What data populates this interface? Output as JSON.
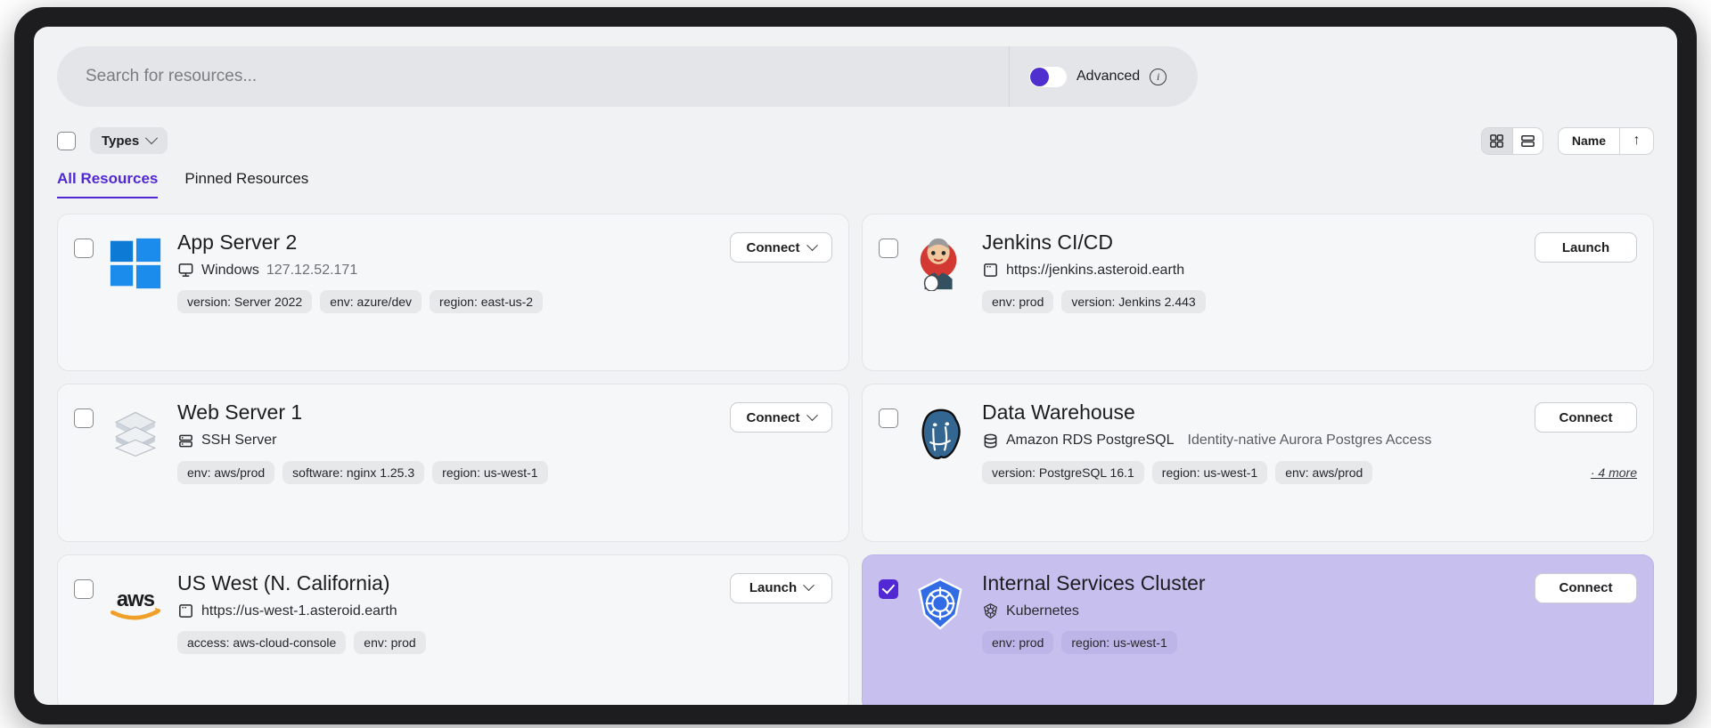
{
  "search": {
    "placeholder": "Search for resources...",
    "value": "",
    "advanced_label": "Advanced",
    "advanced_on": false,
    "info_glyph": "i"
  },
  "filters": {
    "types_label": "Types",
    "select_all_checked": false
  },
  "view": {
    "grid_active": true,
    "sort_label": "Name",
    "sort_arrow": "↑"
  },
  "tabs": [
    {
      "label": "All Resources",
      "active": true
    },
    {
      "label": "Pinned Resources",
      "active": false
    }
  ],
  "colors": {
    "accent": "#5128d4",
    "toggle_knob": "#4f30cf",
    "selected_card_bg": "#c7c0ef",
    "card_bg": "#f6f7f8",
    "page_bg": "#f1f2f4",
    "frame": "#1d1d1f"
  },
  "cards": [
    {
      "name": "App Server 2",
      "logo": "windows-logo",
      "type_icon": "monitor-icon",
      "type_label": "Windows",
      "address": "127.12.52.171",
      "description": "",
      "tags": [
        "version: Server 2022",
        "env: azure/dev",
        "region: east-us-2"
      ],
      "more_label": "",
      "action_label": "Connect",
      "action_has_chevron": true,
      "selected": false
    },
    {
      "name": "Jenkins CI/CD",
      "logo": "jenkins-logo",
      "type_icon": "app-window-icon",
      "type_label": "https://jenkins.asteroid.earth",
      "address": "",
      "description": "",
      "tags": [
        "env: prod",
        "version: Jenkins 2.443"
      ],
      "more_label": "",
      "action_label": "Launch",
      "action_has_chevron": false,
      "selected": false
    },
    {
      "name": "Web Server 1",
      "logo": "server-stack-logo",
      "type_icon": "server-rack-icon",
      "type_label": "SSH Server",
      "address": "",
      "description": "",
      "tags": [
        "env: aws/prod",
        "software: nginx 1.25.3",
        "region: us-west-1"
      ],
      "more_label": "",
      "action_label": "Connect",
      "action_has_chevron": true,
      "selected": false
    },
    {
      "name": "Data Warehouse",
      "logo": "postgresql-logo",
      "type_icon": "database-icon",
      "type_label": "Amazon RDS PostgreSQL",
      "address": "",
      "description": "Identity-native Aurora Postgres Access",
      "tags": [
        "version: PostgreSQL 16.1",
        "region: us-west-1",
        "env: aws/prod"
      ],
      "more_label": "· 4 more",
      "action_label": "Connect",
      "action_has_chevron": false,
      "selected": false
    },
    {
      "name": "US West (N. California)",
      "logo": "aws-logo",
      "type_icon": "app-window-icon",
      "type_label": "https://us-west-1.asteroid.earth",
      "address": "",
      "description": "",
      "tags": [
        "access: aws-cloud-console",
        "env: prod"
      ],
      "more_label": "",
      "action_label": "Launch",
      "action_has_chevron": true,
      "selected": false
    },
    {
      "name": "Internal Services Cluster",
      "logo": "kubernetes-logo",
      "type_icon": "kubernetes-icon",
      "type_label": "Kubernetes",
      "address": "",
      "description": "",
      "tags": [
        "env: prod",
        "region: us-west-1"
      ],
      "more_label": "",
      "action_label": "Connect",
      "action_has_chevron": false,
      "selected": true
    }
  ]
}
